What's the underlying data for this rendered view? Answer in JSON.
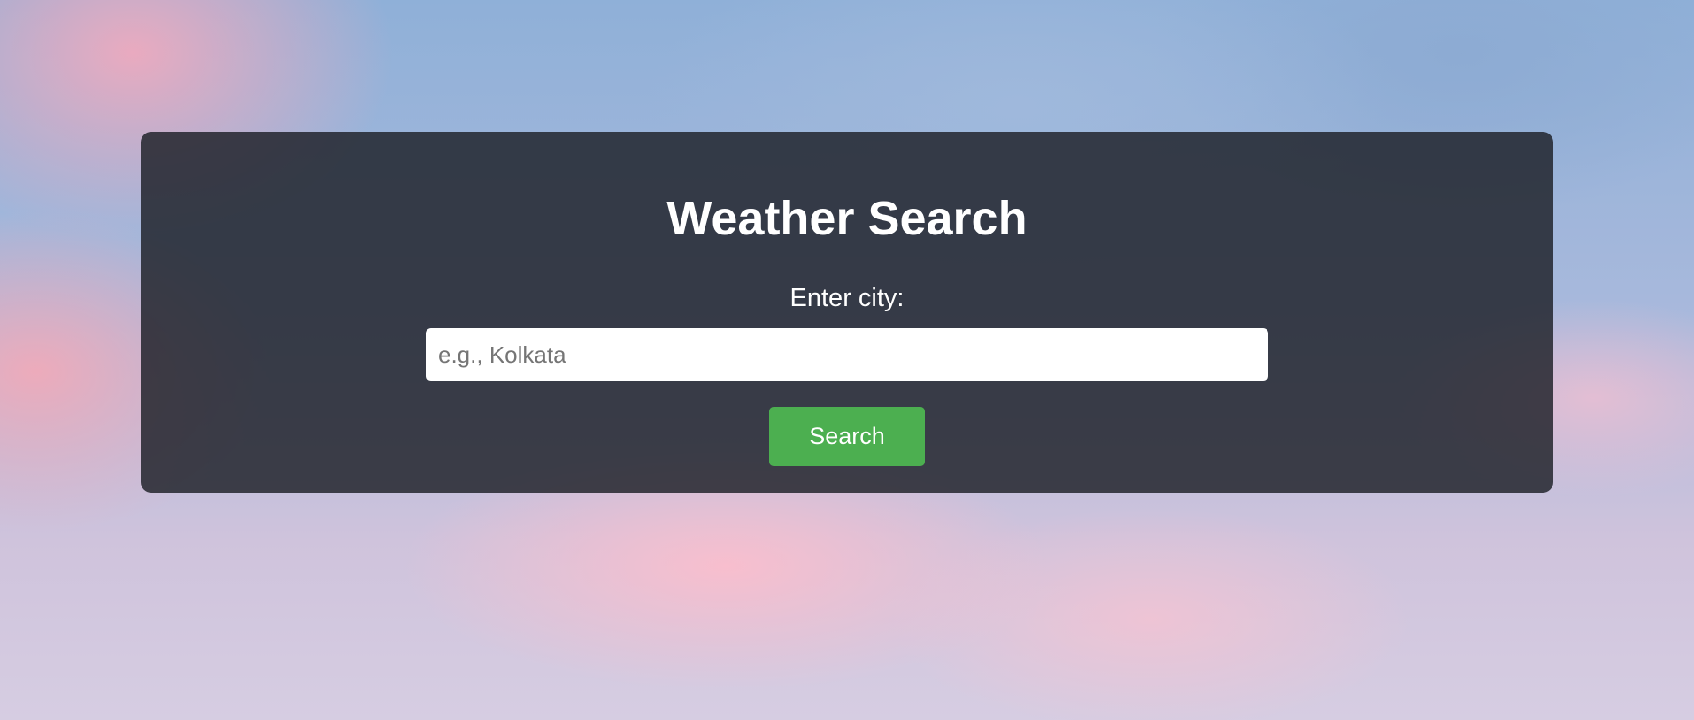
{
  "weather_form": {
    "title": "Weather Search",
    "city_label": "Enter city:",
    "city_input": {
      "value": "",
      "placeholder": "e.g., Kolkata"
    },
    "search_button_label": "Search"
  },
  "colors": {
    "card_background": "#1c1e26",
    "button_accent": "#4caf50",
    "text": "#ffffff"
  }
}
